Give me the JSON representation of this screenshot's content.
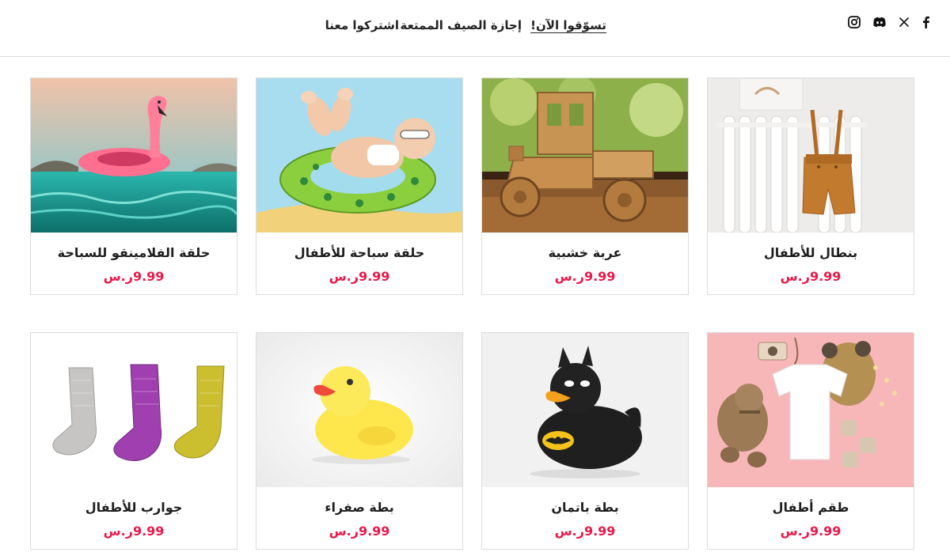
{
  "header": {
    "social_icons": [
      "facebook-icon",
      "x-twitter-icon",
      "discord-icon",
      "instagram-icon"
    ],
    "nav": [
      {
        "label": "تسوّقوا الآن!",
        "active": true
      },
      {
        "label": "إجازة الصيف الممتعة",
        "active": false
      },
      {
        "label": "اشتركوا معنا",
        "active": false
      }
    ]
  },
  "colors": {
    "price": "#e8194a",
    "border": "#dcdcdc"
  },
  "products": [
    {
      "title": "بنطال للأطفال",
      "price": "9.99ر.س",
      "image": "mustard-kids-overalls"
    },
    {
      "title": "عربة خشبية",
      "price": "9.99ر.س",
      "image": "wooden-toy-truck"
    },
    {
      "title": "حلقة سباحة للأطفال",
      "price": "9.99ر.س",
      "image": "baby-in-swim-ring"
    },
    {
      "title": "حلقة الفلامينقو للسباحة",
      "price": "9.99ر.س",
      "image": "flamingo-float"
    },
    {
      "title": "طقم أطفال",
      "price": "9.99ر.س",
      "image": "kids-clothing-set"
    },
    {
      "title": "بطة باتمان",
      "price": "9.99ر.س",
      "image": "batman-rubber-duck"
    },
    {
      "title": "بطة صفراء",
      "price": "9.99ر.س",
      "image": "yellow-rubber-duck"
    },
    {
      "title": "جوارب للأطفال",
      "price": "9.99ر.س",
      "image": "kids-socks"
    }
  ]
}
